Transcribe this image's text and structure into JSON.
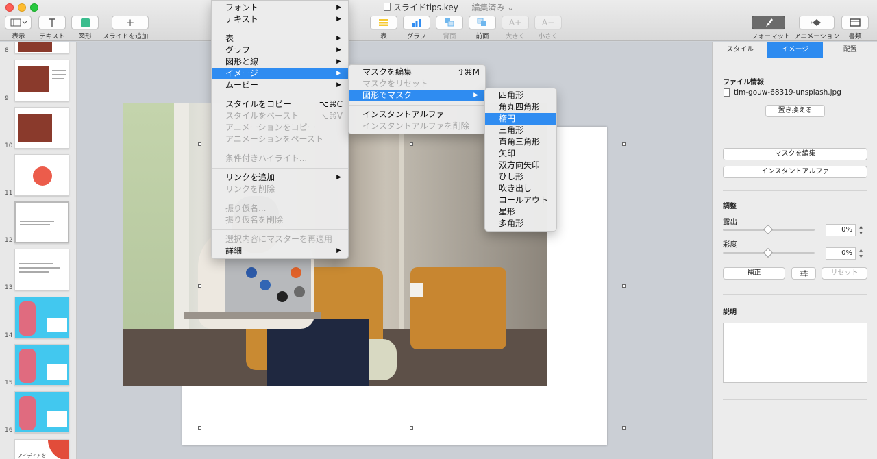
{
  "window": {
    "title": "スライドtips.key",
    "title_status": "— 編集済み ⌄"
  },
  "toolbar": {
    "left": [
      {
        "label": "表示"
      },
      {
        "label": "テキスト"
      },
      {
        "label": "図形"
      },
      {
        "label": "スライドを追加"
      }
    ],
    "center": [
      {
        "label": "表"
      },
      {
        "label": "グラフ"
      },
      {
        "label": "背面"
      },
      {
        "label": "前面"
      },
      {
        "label": "大きく"
      },
      {
        "label": "小さく"
      }
    ],
    "right": [
      {
        "label": "フォーマット"
      },
      {
        "label": "アニメーション"
      },
      {
        "label": "書類"
      }
    ]
  },
  "sidebar": {
    "slides": [
      "8",
      "9",
      "10",
      "11",
      "12",
      "13",
      "14",
      "15",
      "16"
    ],
    "thumb_text": "アイディアを"
  },
  "menu_main": {
    "items": [
      {
        "label": "フォント",
        "sub": true
      },
      {
        "label": "テキスト",
        "sub": true
      },
      {
        "label": "表",
        "sub": true
      },
      {
        "label": "グラフ",
        "sub": true
      },
      {
        "label": "図形と線",
        "sub": true
      },
      {
        "label": "イメージ",
        "sub": true
      },
      {
        "label": "ムービー",
        "sub": true
      },
      {
        "label": "スタイルをコピー",
        "shortcut": "⌥⌘C"
      },
      {
        "label": "スタイルをペースト",
        "shortcut": "⌥⌘V"
      },
      {
        "label": "アニメーションをコピー"
      },
      {
        "label": "アニメーションをペースト"
      },
      {
        "label": "条件付きハイライト..."
      },
      {
        "label": "リンクを追加",
        "sub": true
      },
      {
        "label": "リンクを削除"
      },
      {
        "label": "振り仮名..."
      },
      {
        "label": "振り仮名を削除"
      },
      {
        "label": "選択内容にマスターを再適用"
      },
      {
        "label": "詳細",
        "sub": true
      }
    ]
  },
  "menu_image": {
    "items": [
      {
        "label": "マスクを編集",
        "shortcut": "⇧⌘M"
      },
      {
        "label": "マスクをリセット"
      },
      {
        "label": "図形でマスク"
      },
      {
        "label": "インスタントアルファ"
      },
      {
        "label": "インスタントアルファを削除"
      }
    ]
  },
  "menu_shapes": {
    "items": [
      "四角形",
      "角丸四角形",
      "楕円",
      "三角形",
      "直角三角形",
      "矢印",
      "双方向矢印",
      "ひし形",
      "吹き出し",
      "コールアウト",
      "星形",
      "多角形"
    ]
  },
  "inspector": {
    "tabs": [
      "スタイル",
      "イメージ",
      "配置"
    ],
    "file_info_heading": "ファイル情報",
    "file_name": "tim-gouw-68319-unsplash.jpg",
    "replace_button": "置き換える",
    "edit_mask_button": "マスクを編集",
    "instant_alpha_button": "インスタントアルファ",
    "adjust_heading": "調整",
    "exposure_label": "露出",
    "exposure_value": "0%",
    "exposure_level": 0.5,
    "saturation_label": "彩度",
    "saturation_value": "0%",
    "saturation_level": 0.5,
    "enhance_button": "補正",
    "reset_button": "リセット",
    "description_heading": "説明",
    "description_value": ""
  },
  "colors": {
    "accent": "#2f8cf1",
    "menu_bg": "#ececec"
  }
}
